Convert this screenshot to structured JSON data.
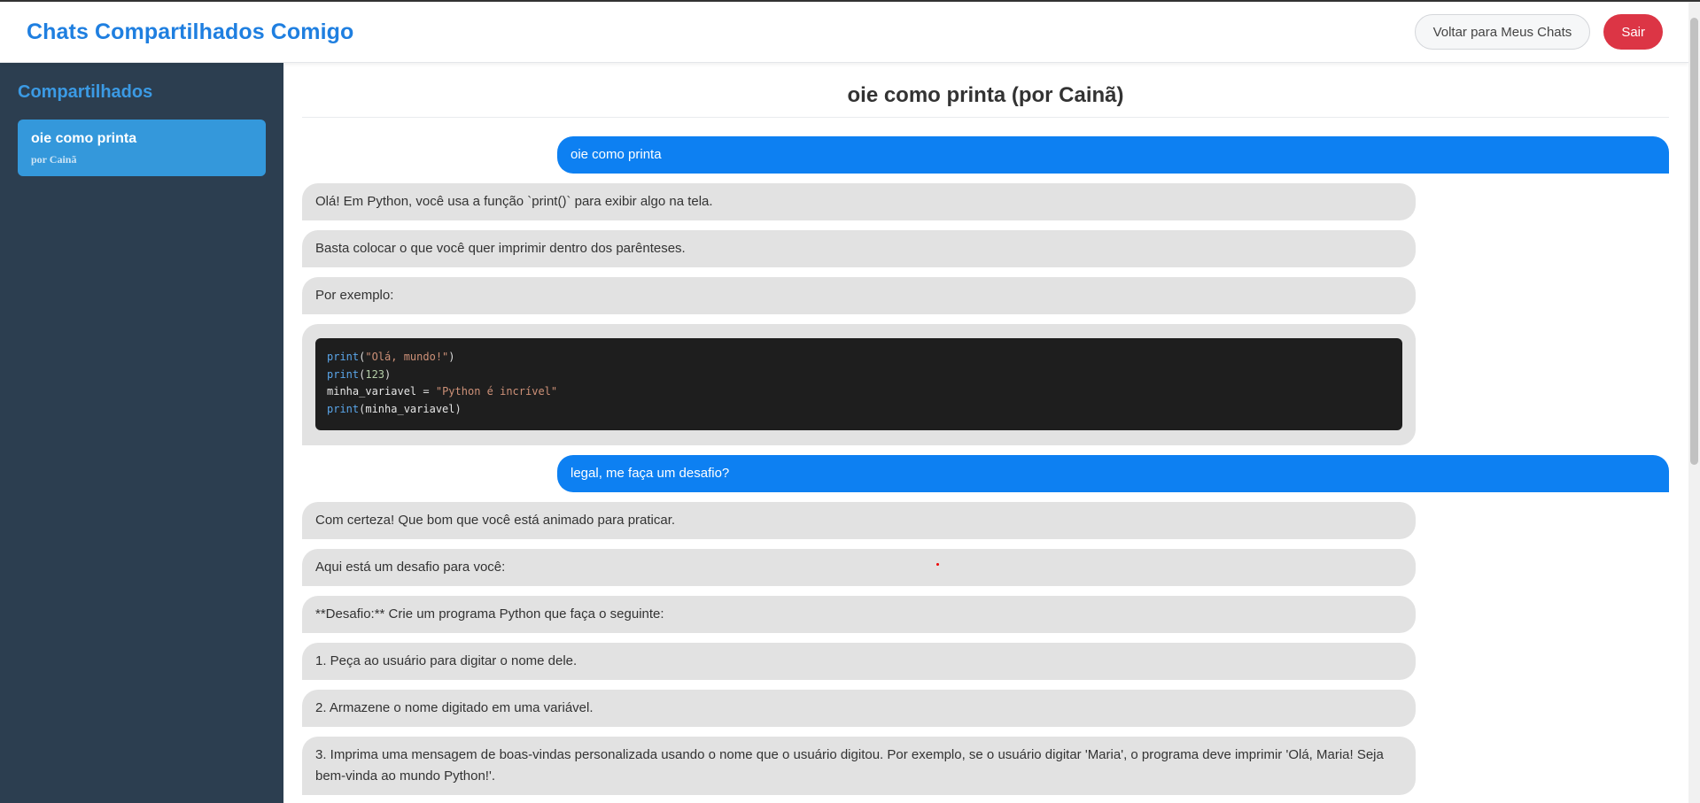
{
  "header": {
    "title": "Chats Compartilhados Comigo",
    "back_label": "Voltar para Meus Chats",
    "logout_label": "Sair"
  },
  "sidebar": {
    "heading": "Compartilhados",
    "items": [
      {
        "title": "oie como printa",
        "author": "por Cainã"
      }
    ]
  },
  "chat": {
    "title": "oie como printa (por Cainã)",
    "messages": [
      {
        "role": "user",
        "text": "oie como printa"
      },
      {
        "role": "bot",
        "text": "Olá! Em Python, você usa a função `print()` para exibir algo na tela."
      },
      {
        "role": "bot",
        "text": "Basta colocar o que você quer imprimir dentro dos parênteses."
      },
      {
        "role": "bot",
        "text": "Por exemplo:"
      },
      {
        "role": "bot",
        "code": [
          "print(\"Olá, mundo!\")",
          "print(123)",
          "minha_variavel = \"Python é incrível\"",
          "print(minha_variavel)"
        ]
      },
      {
        "role": "user",
        "text": "legal, me faça um desafio?"
      },
      {
        "role": "bot",
        "text": "Com certeza! Que bom que você está animado para praticar."
      },
      {
        "role": "bot",
        "text": "Aqui está um desafio para você:"
      },
      {
        "role": "bot",
        "text": "**Desafio:** Crie um programa Python que faça o seguinte:"
      },
      {
        "role": "bot",
        "text": "1. Peça ao usuário para digitar o nome dele."
      },
      {
        "role": "bot",
        "text": "2. Armazene o nome digitado em uma variável."
      },
      {
        "role": "bot",
        "text": "3. Imprima uma mensagem de boas-vindas personalizada usando o nome que o usuário digitou. Por exemplo, se o usuário digitar 'Maria', o programa deve imprimir 'Olá, Maria! Seja bem-vinda ao mundo Python!'."
      }
    ]
  },
  "colors": {
    "brand": "#1f7fe0",
    "user_bubble": "#0d80f2",
    "bot_bubble": "#e2e2e2",
    "sidebar_bg": "#2c3e50",
    "sidebar_active": "#3498db",
    "danger": "#dc3545"
  }
}
